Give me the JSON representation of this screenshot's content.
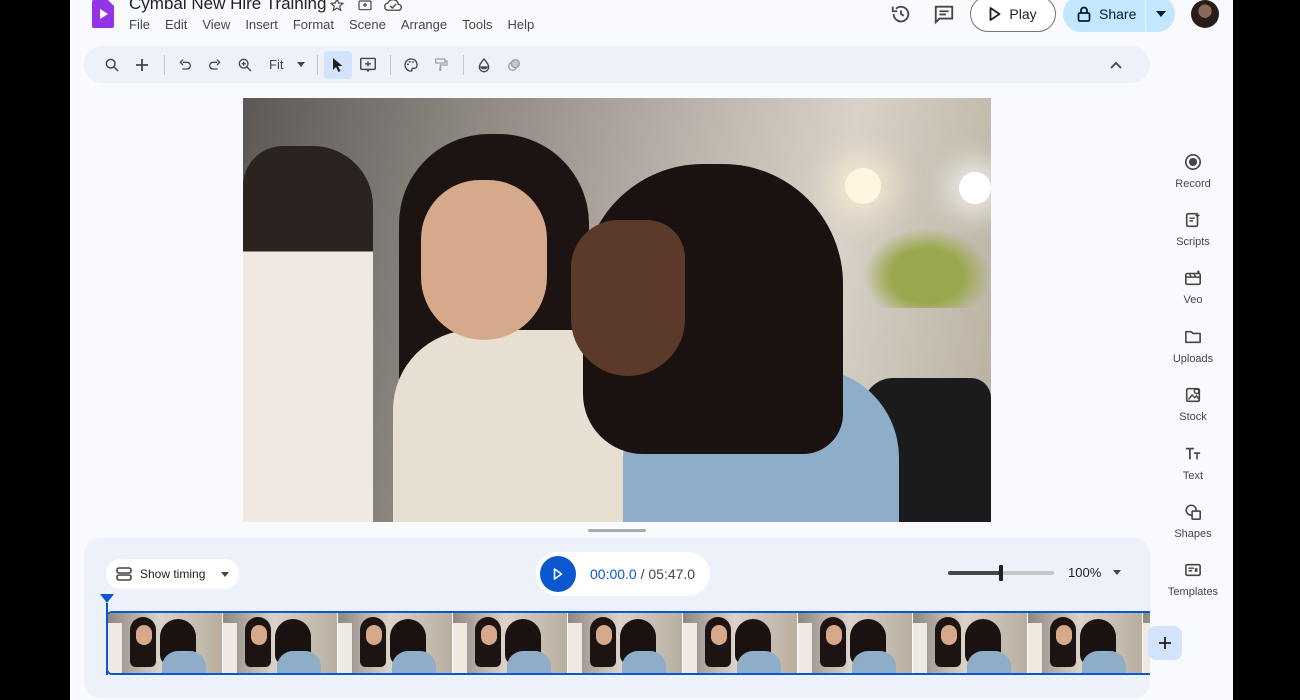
{
  "header": {
    "title": "Cymbal New Hire Training",
    "menu": [
      "File",
      "Edit",
      "View",
      "Insert",
      "Format",
      "Scene",
      "Arrange",
      "Tools",
      "Help"
    ],
    "play_label": "Play",
    "share_label": "Share"
  },
  "toolbar": {
    "zoom_label": "Fit"
  },
  "side_panel": {
    "items": [
      {
        "label": "Record",
        "icon": "record-icon"
      },
      {
        "label": "Scripts",
        "icon": "scripts-icon"
      },
      {
        "label": "Veo",
        "icon": "veo-icon"
      },
      {
        "label": "Uploads",
        "icon": "folder-icon"
      },
      {
        "label": "Stock",
        "icon": "stock-icon"
      },
      {
        "label": "Text",
        "icon": "text-icon"
      },
      {
        "label": "Shapes",
        "icon": "shapes-icon"
      },
      {
        "label": "Templates",
        "icon": "templates-icon"
      }
    ]
  },
  "timeline": {
    "show_timing_label": "Show timing",
    "current_time": "00:00.0",
    "total_time": " / 05:47.0",
    "zoom_percent": "100%",
    "zoom_slider_level": 0.5
  },
  "colors": {
    "accent": "#0b57d0",
    "share_bg": "#c2e7ff",
    "app_bg": "#f8fafd",
    "toolbar_bg": "#edf2fa",
    "logo": "#9334e6"
  }
}
